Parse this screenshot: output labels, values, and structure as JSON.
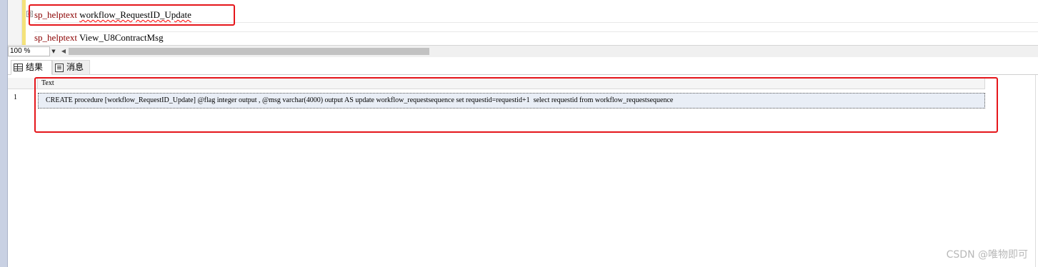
{
  "editor": {
    "lines": [
      {
        "keyword": "sp_helptext",
        "argument": "workflow_RequestID_Update"
      },
      {
        "keyword": "sp_helptext",
        "argument": "View_U8ContractMsg"
      }
    ],
    "fold_marker": "⊟"
  },
  "zoom": {
    "value": "100 %"
  },
  "tabs": [
    {
      "label": "结果",
      "icon": "grid-icon",
      "active": true
    },
    {
      "label": "消息",
      "icon": "messages-icon",
      "active": false
    }
  ],
  "results": {
    "columns": [
      "Text"
    ],
    "rows": [
      {
        "number": "1",
        "text": "CREATE procedure [workflow_RequestID_Update] @flag integer output , @msg varchar(4000) output AS update workflow_requestsequence set requestid=requestid+1  select requestid from workflow_requestsequence"
      }
    ]
  },
  "watermark": "CSDN @唯物即可",
  "colors": {
    "highlight_box": "#e5161b",
    "keyword": "#8b0000",
    "selected_cell": "#e9eef6"
  }
}
